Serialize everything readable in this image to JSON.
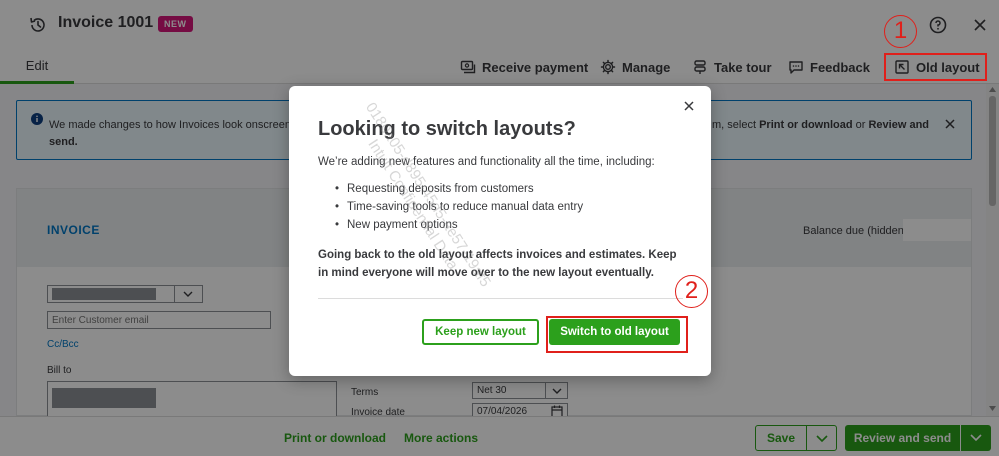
{
  "header": {
    "title": "Invoice 1001",
    "badge": "NEW"
  },
  "tabs": {
    "edit": "Edit"
  },
  "toolbar": {
    "receive_payment": "Receive payment",
    "manage": "Manage",
    "take_tour": "Take tour",
    "feedback": "Feedback",
    "old_layout": "Old layout"
  },
  "banner": {
    "text_left": "We made changes to how Invoices look onscreen so",
    "text_left_2": "send.",
    "text_right_prefix": "m, select ",
    "print_or_download": "Print or download",
    "or": " or ",
    "review_and": "Review and"
  },
  "form": {
    "invoice_label": "INVOICE",
    "balance_label": "Balance due (hidden):",
    "email_placeholder": "Enter Customer email",
    "ccbcc": "Cc/Bcc",
    "bill_to": "Bill to",
    "terms_label": "Terms",
    "terms_value": "Net 30",
    "invoice_date_label": "Invoice date",
    "invoice_date_value": "07/04/2026"
  },
  "footer": {
    "print_or_download": "Print or download",
    "more_actions": "More actions",
    "save": "Save",
    "review_and_send": "Review and send"
  },
  "modal": {
    "title": "Looking to switch layouts?",
    "intro": "We’re adding new features and functionality all the time, including:",
    "items": [
      "Requesting deposits from customers",
      "Time-saving tools to reduce manual data entry",
      "New payment options"
    ],
    "warning": "Going back to the old layout affects invoices and estimates. Keep in mind everyone will move over to the new layout eventually.",
    "keep_button": "Keep new layout",
    "switch_button": "Switch to old layout"
  },
  "watermark": {
    "line1": "0180a05-d895-45d5-ae57-19af5",
    "line2": "Intuit Confidential Data"
  },
  "annotations": {
    "step1": "1",
    "step2": "2",
    "highlight_color": "#e0201b"
  },
  "colors": {
    "brand_green": "#2ca01c",
    "link_blue": "#0077c5",
    "new_badge": "#d6177a"
  }
}
